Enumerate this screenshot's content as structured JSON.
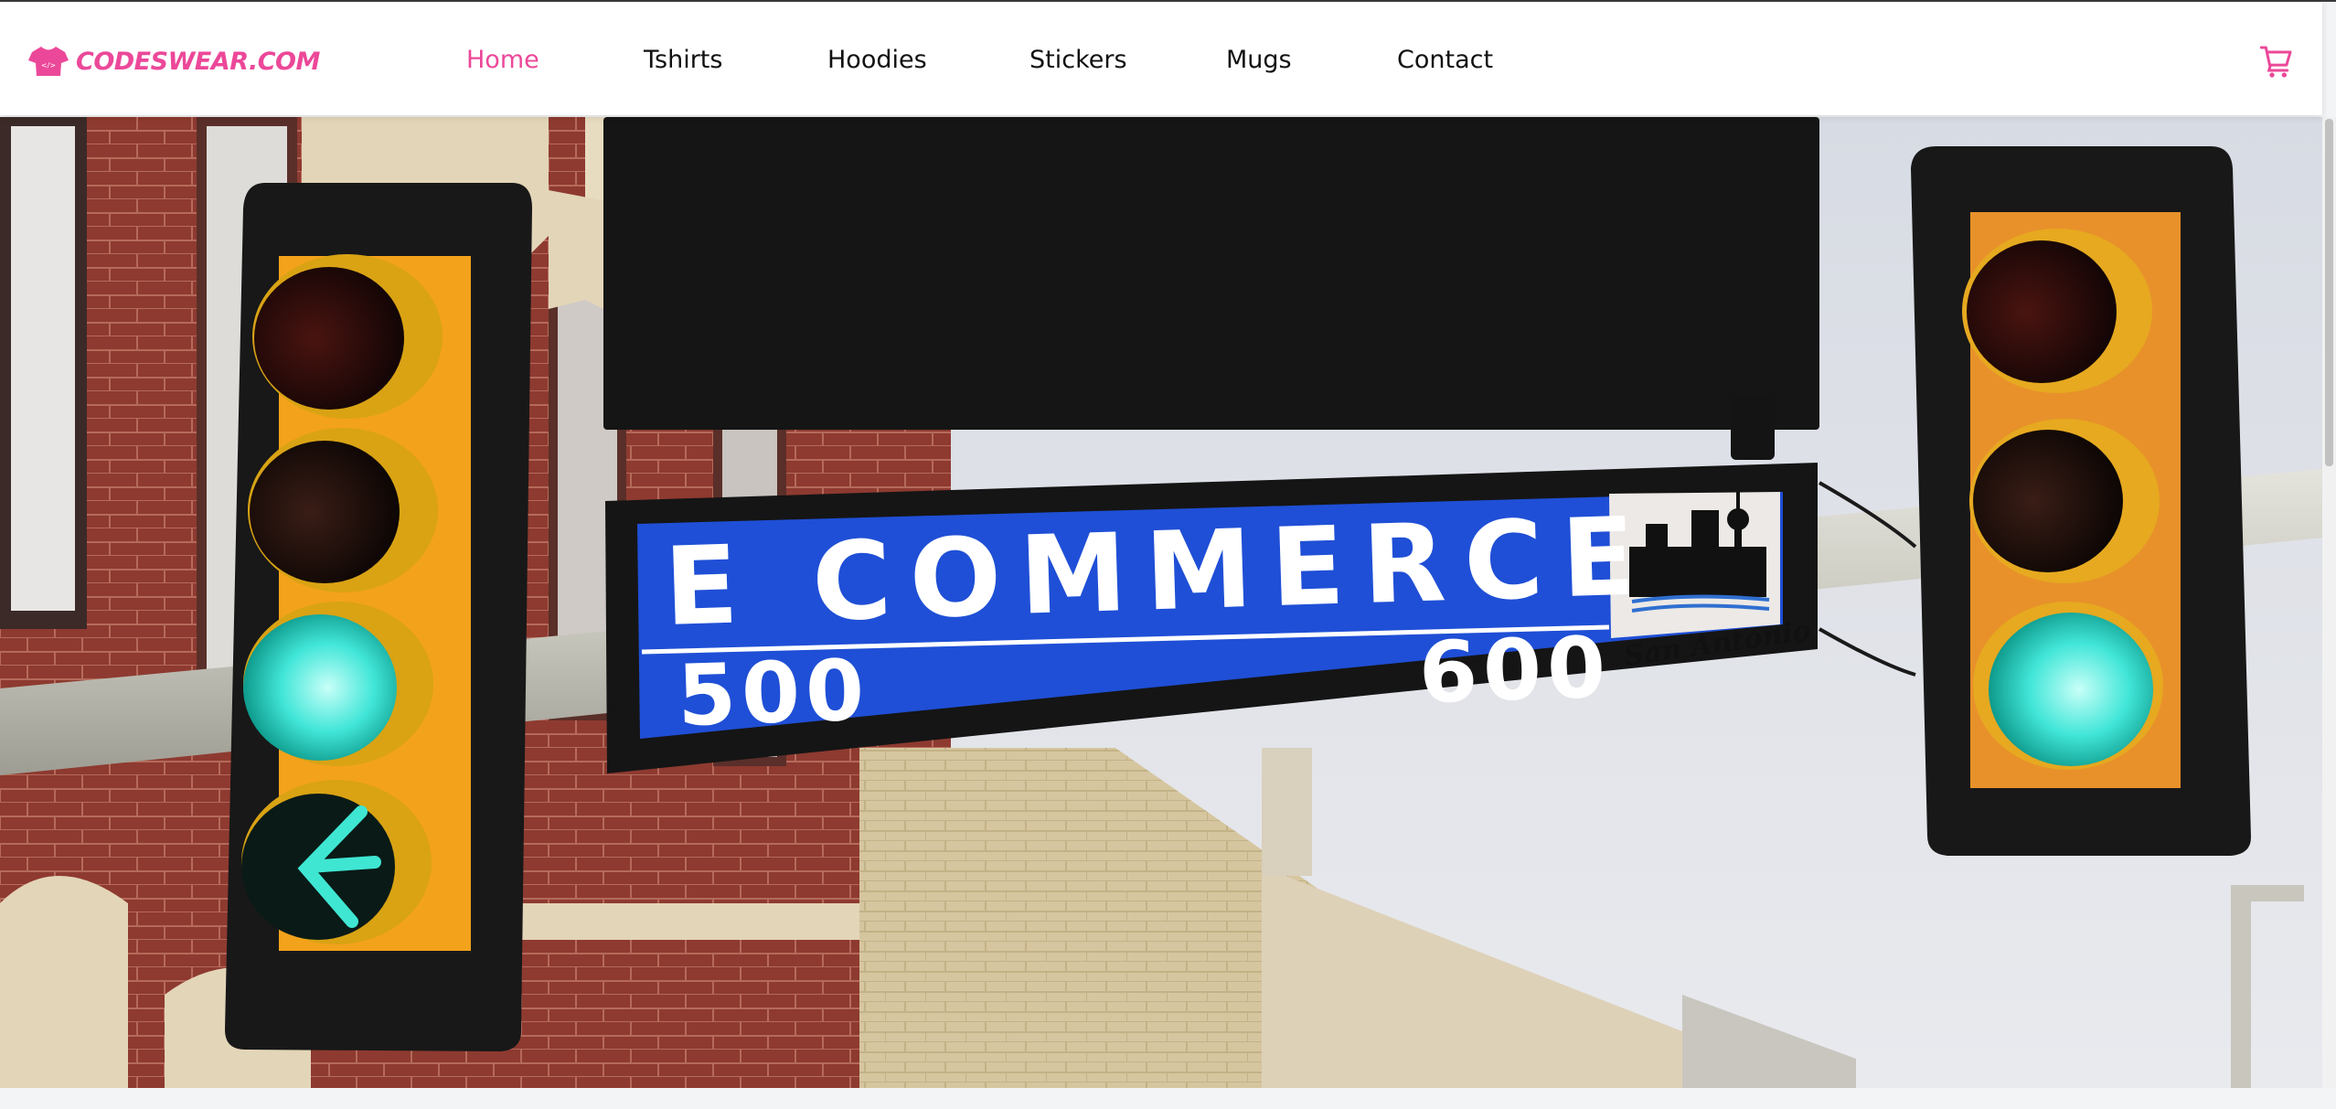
{
  "brand": {
    "name": "CODESWEAR.COM",
    "logo_icon": "tshirt-icon",
    "color": "#ec4899"
  },
  "nav": {
    "items": [
      {
        "label": "Home",
        "active": true
      },
      {
        "label": "Tshirts",
        "active": false
      },
      {
        "label": "Hoodies",
        "active": false
      },
      {
        "label": "Stickers",
        "active": false
      },
      {
        "label": "Mugs",
        "active": false
      },
      {
        "label": "Contact",
        "active": false
      }
    ],
    "active_color": "#ec4899",
    "cart_icon": "shopping-cart-icon"
  },
  "hero": {
    "sign": {
      "street": "E COMMERCE",
      "left_number": "500",
      "right_number": "600",
      "city": "San Antonio",
      "sign_color": "#1f4fd6"
    }
  }
}
